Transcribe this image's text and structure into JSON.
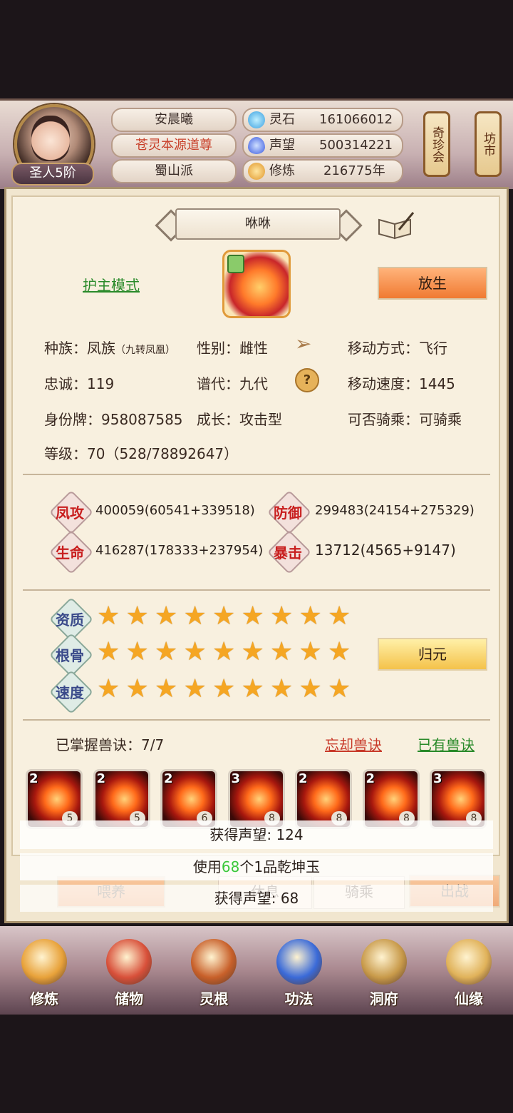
{
  "header": {
    "rank": "圣人5阶",
    "name": "安晨曦",
    "title": "苍灵本源道尊",
    "sect": "蜀山派",
    "resources": [
      {
        "label": "灵石",
        "value": "161066012",
        "icon": "spirit-stone-icon"
      },
      {
        "label": "声望",
        "value": "500314221",
        "icon": "reputation-icon"
      },
      {
        "label": "修炼",
        "value": "216775年",
        "icon": "cultivation-icon"
      }
    ],
    "lanterns": [
      {
        "label": "奇珍会"
      },
      {
        "label": "坊市"
      }
    ]
  },
  "pet": {
    "name": "咻咻",
    "guard_mode": "护主模式",
    "release_label": "放生",
    "info": {
      "race_label": "种族：",
      "race_value": "凤族",
      "race_sub": "（九转凤凰）",
      "gender_label": "性别：",
      "gender_value": "雌性",
      "move_label": "移动方式：",
      "move_value": "飞行",
      "loyalty_label": "忠诚：",
      "loyalty_value": "119",
      "gen_label": "谱代：",
      "gen_value": "九代",
      "speed_label": "移动速度：",
      "speed_value": "1445",
      "id_label": "身份牌：",
      "id_value": "958087585",
      "growth_label": "成长：",
      "growth_value": "攻击型",
      "ride_label": "可否骑乘：",
      "ride_value": "可骑乘",
      "level_label": "等级：",
      "level_value": "70（528/78892647）"
    },
    "stats": [
      {
        "label": "凤攻",
        "value": "400059(60541+339518)"
      },
      {
        "label": "防御",
        "value": "299483(24154+275329)"
      },
      {
        "label": "生命",
        "value": "416287(178333+237954)"
      },
      {
        "label": "暴击",
        "value": "13712(4565+9147)"
      }
    ],
    "aptitudes": [
      {
        "label": "资质",
        "stars": 9
      },
      {
        "label": "根骨",
        "stars": 9
      },
      {
        "label": "速度",
        "stars": 9
      }
    ],
    "reset_label": "归元",
    "skills_label": "已掌握兽诀：7/7",
    "forget_label": "忘却兽诀",
    "owned_label": "已有兽诀",
    "skills": [
      {
        "level": "2",
        "tag": "5"
      },
      {
        "level": "2",
        "tag": "5"
      },
      {
        "level": "2",
        "tag": "6"
      },
      {
        "level": "3",
        "tag": "8"
      },
      {
        "level": "2",
        "tag": "8"
      },
      {
        "level": "2",
        "tag": "8"
      },
      {
        "level": "3",
        "tag": "8"
      }
    ]
  },
  "toasts": {
    "t1": "获得声望: 124",
    "t2_pre": "使用",
    "t2_num": "68",
    "t2_post": "个1品乾坤玉",
    "t3": "获得声望: 68"
  },
  "actions": {
    "feed": "喂养",
    "rest": "休息",
    "ride": "骑乘",
    "battle": "出战"
  },
  "nav": [
    {
      "label": "修炼",
      "icon": "monk-icon"
    },
    {
      "label": "储物",
      "icon": "bag-icon"
    },
    {
      "label": "灵根",
      "icon": "spirit-root-icon"
    },
    {
      "label": "功法",
      "icon": "book-icon"
    },
    {
      "label": "洞府",
      "icon": "cave-mansion-icon"
    },
    {
      "label": "仙缘",
      "icon": "gourd-icon"
    }
  ]
}
